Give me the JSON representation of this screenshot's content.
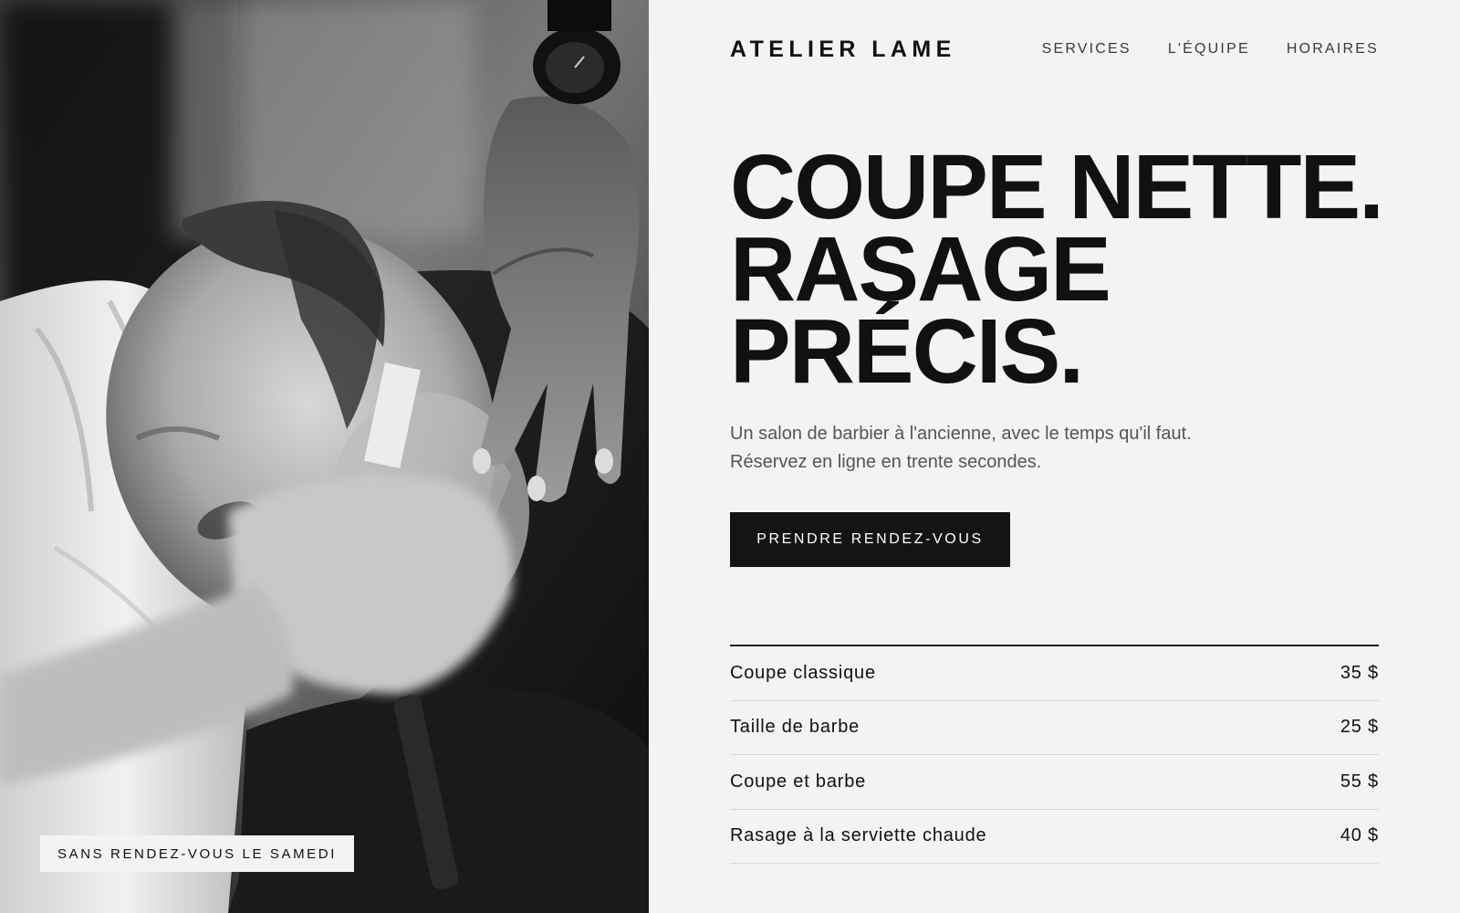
{
  "brand": {
    "name": "ATELIER LAME"
  },
  "nav": {
    "items": [
      {
        "label": "SERVICES"
      },
      {
        "label": "L'ÉQUIPE"
      },
      {
        "label": "HORAIRES"
      }
    ]
  },
  "hero": {
    "title_lines": [
      "COUPE NETTE.",
      "RASAGE",
      "PRÉCIS."
    ],
    "subtitle_lines": [
      "Un salon de barbier à l'ancienne, avec le temps qu'il faut.",
      "Réservez en ligne en trente secondes."
    ],
    "cta_label": "PRENDRE RENDEZ-VOUS"
  },
  "services": [
    {
      "name": "Coupe classique",
      "price": "35 $"
    },
    {
      "name": "Taille de barbe",
      "price": "25 $"
    },
    {
      "name": "Coupe et barbe",
      "price": "55 $"
    },
    {
      "name": "Rasage à la serviette chaude",
      "price": "40 $"
    }
  ],
  "photo": {
    "badge": "SANS RENDEZ-VOUS LE SAMEDI",
    "style": "black-and-white",
    "subject": "barber shaving a client with a straight razor"
  },
  "colors": {
    "background": "#f3f3f1",
    "ink": "#111111",
    "muted_text": "#555555",
    "button": "#141414"
  }
}
